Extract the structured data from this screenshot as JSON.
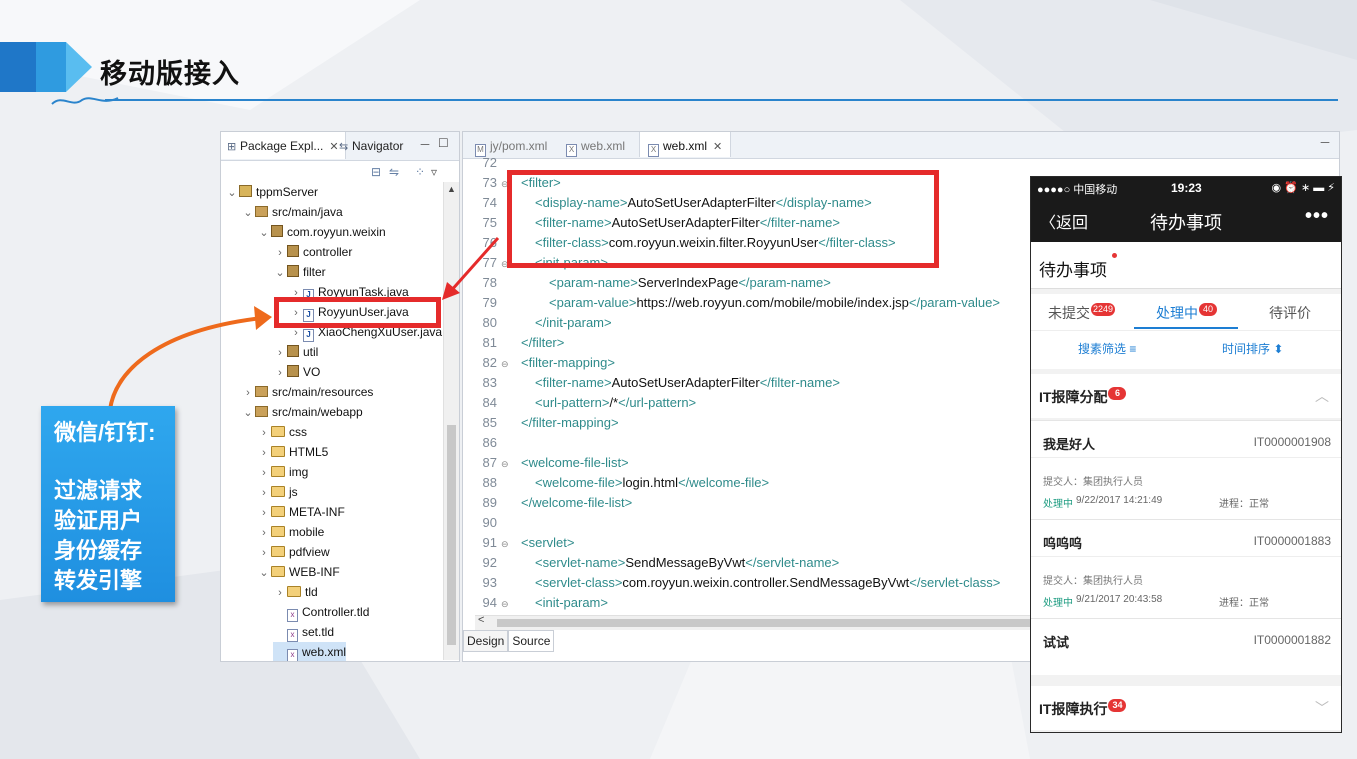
{
  "slide": {
    "title": "移动版接入"
  },
  "package_explorer": {
    "tab_package": "Package Expl...",
    "tab_package_close": "✕",
    "tab_navigator": "Navigator",
    "minimize": "－",
    "maximize": "☐",
    "tree": [
      {
        "label": "tppmServer",
        "icon": "project-icon",
        "twisty": "⌄",
        "indent": 0
      },
      {
        "label": "src/main/java",
        "icon": "source-folder-icon",
        "twisty": "⌄",
        "indent": 1
      },
      {
        "label": "com.royyun.weixin",
        "icon": "package-icon",
        "twisty": "⌄",
        "indent": 2
      },
      {
        "label": "controller",
        "icon": "package-icon",
        "twisty": "›",
        "indent": 3
      },
      {
        "label": "filter",
        "icon": "package-icon",
        "twisty": "⌄",
        "indent": 3
      },
      {
        "label": "RoyyunTask.java",
        "icon": "java-file-icon",
        "twisty": "›",
        "indent": 4
      },
      {
        "label": "RoyyunUser.java",
        "icon": "java-file-icon",
        "twisty": "›",
        "indent": 4
      },
      {
        "label": "XiaoChengXuUser.java",
        "icon": "java-file-icon",
        "twisty": "›",
        "indent": 4
      },
      {
        "label": "util",
        "icon": "package-icon",
        "twisty": "›",
        "indent": 3
      },
      {
        "label": "VO",
        "icon": "package-icon",
        "twisty": "›",
        "indent": 3
      },
      {
        "label": "src/main/resources",
        "icon": "source-folder-icon",
        "twisty": "›",
        "indent": 1
      },
      {
        "label": "src/main/webapp",
        "icon": "source-folder-icon",
        "twisty": "⌄",
        "indent": 1
      },
      {
        "label": "css",
        "icon": "folder-icon",
        "twisty": "›",
        "indent": 2
      },
      {
        "label": "HTML5",
        "icon": "folder-icon",
        "twisty": "›",
        "indent": 2
      },
      {
        "label": "img",
        "icon": "folder-icon",
        "twisty": "›",
        "indent": 2
      },
      {
        "label": "js",
        "icon": "folder-icon",
        "twisty": "›",
        "indent": 2
      },
      {
        "label": "META-INF",
        "icon": "folder-icon",
        "twisty": "›",
        "indent": 2
      },
      {
        "label": "mobile",
        "icon": "folder-icon",
        "twisty": "›",
        "indent": 2
      },
      {
        "label": "pdfview",
        "icon": "folder-icon",
        "twisty": "›",
        "indent": 2
      },
      {
        "label": "WEB-INF",
        "icon": "folder-icon",
        "twisty": "⌄",
        "indent": 2
      },
      {
        "label": "tld",
        "icon": "folder-icon",
        "twisty": "›",
        "indent": 3
      },
      {
        "label": "Controller.tld",
        "icon": "xml-file-icon",
        "twisty": "",
        "indent": 3
      },
      {
        "label": "set.tld",
        "icon": "xml-file-icon",
        "twisty": "",
        "indent": 3
      },
      {
        "label": "web.xml",
        "icon": "xml-file-icon",
        "twisty": "",
        "indent": 3,
        "selected": true
      }
    ]
  },
  "editor": {
    "tabs": [
      {
        "label": "jy/pom.xml",
        "active": false,
        "icon": "M"
      },
      {
        "label": "web.xml",
        "active": false,
        "icon": "X"
      },
      {
        "label": "web.xml",
        "active": true,
        "icon": "X",
        "close": "✕"
      }
    ],
    "minimize": "－",
    "lines": [
      {
        "n": "72",
        "fold": "",
        "indent": 0,
        "parts": []
      },
      {
        "n": "73",
        "fold": "⊖",
        "indent": 0,
        "parts": [
          [
            "t",
            "<filter>"
          ]
        ]
      },
      {
        "n": "74",
        "fold": "",
        "indent": 1,
        "parts": [
          [
            "t",
            "<display-name>"
          ],
          [
            "x",
            "AutoSetUserAdapterFilter"
          ],
          [
            "t",
            "</display-name>"
          ]
        ]
      },
      {
        "n": "75",
        "fold": "",
        "indent": 1,
        "parts": [
          [
            "t",
            "<filter-name>"
          ],
          [
            "x",
            "AutoSetUserAdapterFilter"
          ],
          [
            "t",
            "</filter-name>"
          ]
        ]
      },
      {
        "n": "76",
        "fold": "",
        "indent": 1,
        "parts": [
          [
            "t",
            "<filter-class>"
          ],
          [
            "x",
            "com.royyun.weixin.filter.RoyyunUser"
          ],
          [
            "t",
            "</filter-class>"
          ]
        ]
      },
      {
        "n": "77",
        "fold": "⊖",
        "indent": 1,
        "parts": [
          [
            "t",
            "<init-param>"
          ]
        ]
      },
      {
        "n": "78",
        "fold": "",
        "indent": 2,
        "parts": [
          [
            "t",
            "<param-name>"
          ],
          [
            "x",
            "ServerIndexPage"
          ],
          [
            "t",
            "</param-name>"
          ]
        ]
      },
      {
        "n": "79",
        "fold": "",
        "indent": 2,
        "parts": [
          [
            "t",
            "<param-value>"
          ],
          [
            "x",
            "https://web.royyun.com/mobile/mobile/index.jsp"
          ],
          [
            "t",
            "</param-value>"
          ]
        ]
      },
      {
        "n": "80",
        "fold": "",
        "indent": 1,
        "parts": [
          [
            "t",
            "</init-param>"
          ]
        ]
      },
      {
        "n": "81",
        "fold": "",
        "indent": 0,
        "parts": [
          [
            "t",
            "</filter>"
          ]
        ]
      },
      {
        "n": "82",
        "fold": "⊖",
        "indent": 0,
        "parts": [
          [
            "t",
            "<filter-mapping>"
          ]
        ]
      },
      {
        "n": "83",
        "fold": "",
        "indent": 1,
        "parts": [
          [
            "t",
            "<filter-name>"
          ],
          [
            "x",
            "AutoSetUserAdapterFilter"
          ],
          [
            "t",
            "</filter-name>"
          ]
        ]
      },
      {
        "n": "84",
        "fold": "",
        "indent": 1,
        "parts": [
          [
            "t",
            "<url-pattern>"
          ],
          [
            "x",
            "/*"
          ],
          [
            "t",
            "</url-pattern>"
          ]
        ]
      },
      {
        "n": "85",
        "fold": "",
        "indent": 0,
        "parts": [
          [
            "t",
            "</filter-mapping>"
          ]
        ]
      },
      {
        "n": "86",
        "fold": "",
        "indent": 0,
        "parts": []
      },
      {
        "n": "87",
        "fold": "⊖",
        "indent": 0,
        "parts": [
          [
            "t",
            "<welcome-file-list>"
          ]
        ]
      },
      {
        "n": "88",
        "fold": "",
        "indent": 1,
        "parts": [
          [
            "t",
            "<welcome-file>"
          ],
          [
            "x",
            "login.html"
          ],
          [
            "t",
            "</welcome-file>"
          ]
        ]
      },
      {
        "n": "89",
        "fold": "",
        "indent": 0,
        "parts": [
          [
            "t",
            "</welcome-file-list>"
          ]
        ]
      },
      {
        "n": "90",
        "fold": "",
        "indent": 0,
        "parts": []
      },
      {
        "n": "91",
        "fold": "⊖",
        "indent": 0,
        "parts": [
          [
            "t",
            "<servlet>"
          ]
        ]
      },
      {
        "n": "92",
        "fold": "",
        "indent": 1,
        "parts": [
          [
            "t",
            "<servlet-name>"
          ],
          [
            "x",
            "SendMessageByVwt"
          ],
          [
            "t",
            "</servlet-name>"
          ]
        ]
      },
      {
        "n": "93",
        "fold": "",
        "indent": 1,
        "parts": [
          [
            "t",
            "<servlet-class>"
          ],
          [
            "x",
            "com.royyun.weixin.controller.SendMessageByVwt"
          ],
          [
            "t",
            "</servlet-class>"
          ]
        ]
      },
      {
        "n": "94",
        "fold": "⊖",
        "indent": 1,
        "parts": [
          [
            "t",
            "<init-param>"
          ]
        ]
      }
    ],
    "scroll_left": "<",
    "bottom_tabs": [
      "Design",
      "Source"
    ]
  },
  "callout": {
    "line1": "微信/钉钉:",
    "line2": "过滤请求",
    "line3": "验证用户",
    "line4": "身份缓存",
    "line5": "转发引擎"
  },
  "phone": {
    "status": {
      "carrier": "●●●●○ 中国移动 ",
      "time": "19:23",
      "icons": "◉ ⏰ ∗ ▬ ⚡"
    },
    "nav": {
      "back": "〈返回",
      "title": "待办事项",
      "more": "•••"
    },
    "header_title": "待办事项",
    "tabs": [
      {
        "label": "未提交",
        "badge": "2249"
      },
      {
        "label": "处理中",
        "badge": "40"
      },
      {
        "label": "待评价",
        "badge": ""
      }
    ],
    "filter": {
      "search": "搜素筛选 ≡",
      "sort": "时间排序 ⬍"
    },
    "sections": [
      {
        "title": "IT报障分配",
        "badge": "6",
        "chevron": "︿"
      },
      {
        "title": "IT报障执行",
        "badge": "34",
        "chevron": "﹀"
      }
    ],
    "items": [
      {
        "name": "我是好人",
        "id": "IT0000001908",
        "submitter": "提交人：集团执行人员",
        "status": "处理中",
        "time": "9/22/2017 14:21:49",
        "progress": "进程：正常"
      },
      {
        "name": "呜呜呜",
        "id": "IT0000001883",
        "submitter": "提交人：集团执行人员",
        "status": "处理中",
        "time": "9/21/2017 20:43:58",
        "progress": "进程：正常"
      },
      {
        "name": "试试",
        "id": "IT0000001882",
        "submitter": "提交人：集团执行人员",
        "status": "",
        "time": "",
        "progress": ""
      }
    ]
  },
  "colors": {
    "accent_blue": "#1f77c8",
    "highlight_red": "#e52b2b",
    "arrow_orange": "#ee6a1c",
    "xml_tag": "#2f8b8b"
  }
}
